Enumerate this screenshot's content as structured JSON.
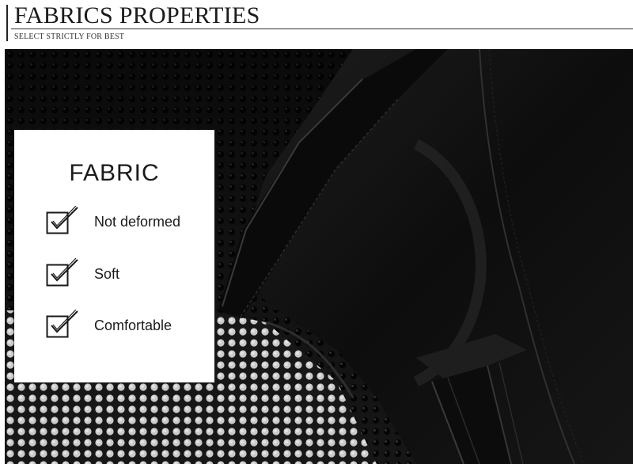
{
  "header": {
    "title": "FABRICS PROPERTIES",
    "subtitle": "SELECT STRICTLY FOR BEST"
  },
  "card": {
    "heading": "FABRIC",
    "features": [
      {
        "label": "Not deformed",
        "icon": "checkbox-icon"
      },
      {
        "label": "Soft",
        "icon": "checkbox-icon"
      },
      {
        "label": "Comfortable",
        "icon": "checkbox-icon"
      }
    ]
  },
  "colors": {
    "fabric_black": "#111111",
    "mesh_highlight": "#e6e6e6",
    "card_bg": "#ffffff",
    "text": "#1a1a1a"
  }
}
